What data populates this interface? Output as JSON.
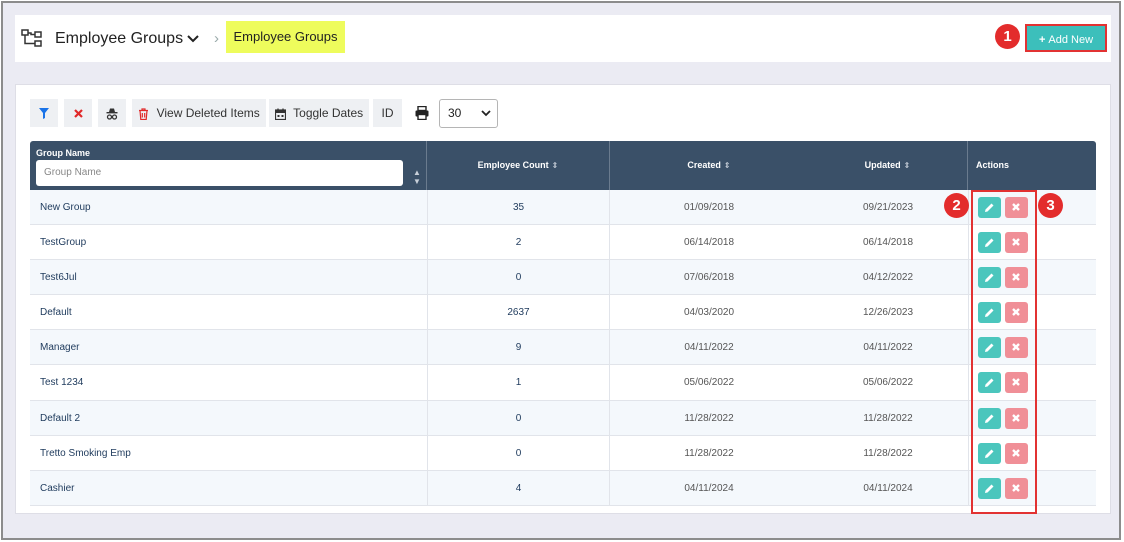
{
  "header": {
    "title": "Employee Groups",
    "breadcrumb": "Employee Groups",
    "add_new_label": "Add New"
  },
  "badges": [
    "1",
    "2",
    "3"
  ],
  "toolbar": {
    "view_deleted_label": "View Deleted Items",
    "toggle_dates_label": "Toggle Dates",
    "id_label": "ID",
    "page_size": "30"
  },
  "table": {
    "columns": {
      "group_name": "Group Name",
      "employee_count": "Employee Count",
      "created": "Created",
      "updated": "Updated",
      "actions": "Actions"
    },
    "filter_placeholder": "Group Name",
    "rows": [
      {
        "name": "New Group",
        "count": "35",
        "created": "01/09/2018",
        "updated": "09/21/2023"
      },
      {
        "name": "TestGroup",
        "count": "2",
        "created": "06/14/2018",
        "updated": "06/14/2018"
      },
      {
        "name": "Test6Jul",
        "count": "0",
        "created": "07/06/2018",
        "updated": "04/12/2022"
      },
      {
        "name": "Default",
        "count": "2637",
        "created": "04/03/2020",
        "updated": "12/26/2023"
      },
      {
        "name": "Manager",
        "count": "9",
        "created": "04/11/2022",
        "updated": "04/11/2022"
      },
      {
        "name": "Test 1234",
        "count": "1",
        "created": "05/06/2022",
        "updated": "05/06/2022"
      },
      {
        "name": "Default 2",
        "count": "0",
        "created": "11/28/2022",
        "updated": "11/28/2022"
      },
      {
        "name": "Tretto Smoking Emp",
        "count": "0",
        "created": "11/28/2022",
        "updated": "11/28/2022"
      },
      {
        "name": "Cashier",
        "count": "4",
        "created": "04/11/2024",
        "updated": "04/11/2024"
      }
    ]
  },
  "colors": {
    "accent": "#3cbfbb",
    "header_bg": "#3a5068",
    "delete": "#f08f97",
    "highlight": "#eefc5c",
    "annotation": "#e32c2c"
  }
}
